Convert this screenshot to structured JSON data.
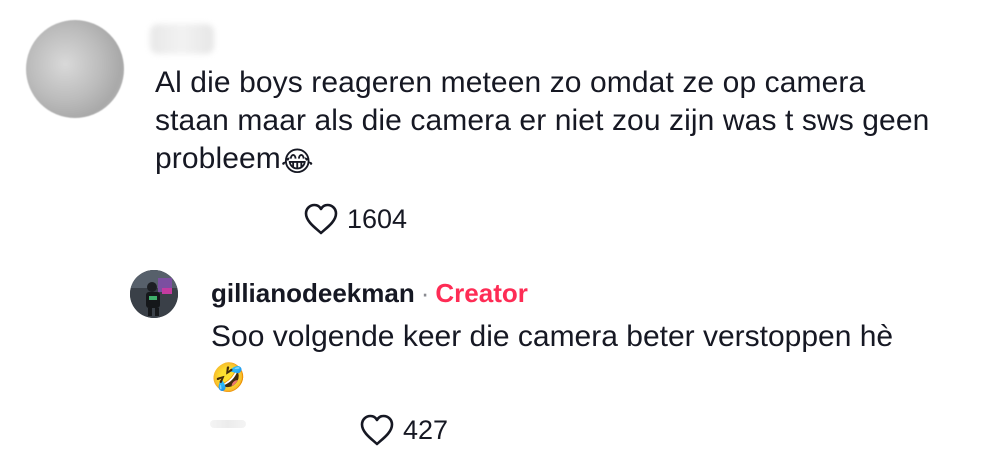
{
  "comment": {
    "username": "",
    "text": "Al die boys reageren meteen zo omdat ze op camera staan maar als die camera er niet zou zijn was t sws geen probleem",
    "emoji": "😂",
    "likes": "1604",
    "avatar_icon": "blurred-avatar"
  },
  "reply": {
    "username": "gillianodeekman",
    "separator": "·",
    "badge": "Creator",
    "badge_color": "#fe2c55",
    "text": "Soo volgende keer die camera beter verstoppen hè",
    "emoji": "🤣",
    "likes": "427",
    "avatar_icon": "user-avatar"
  },
  "icons": {
    "like": "heart-outline-icon"
  }
}
